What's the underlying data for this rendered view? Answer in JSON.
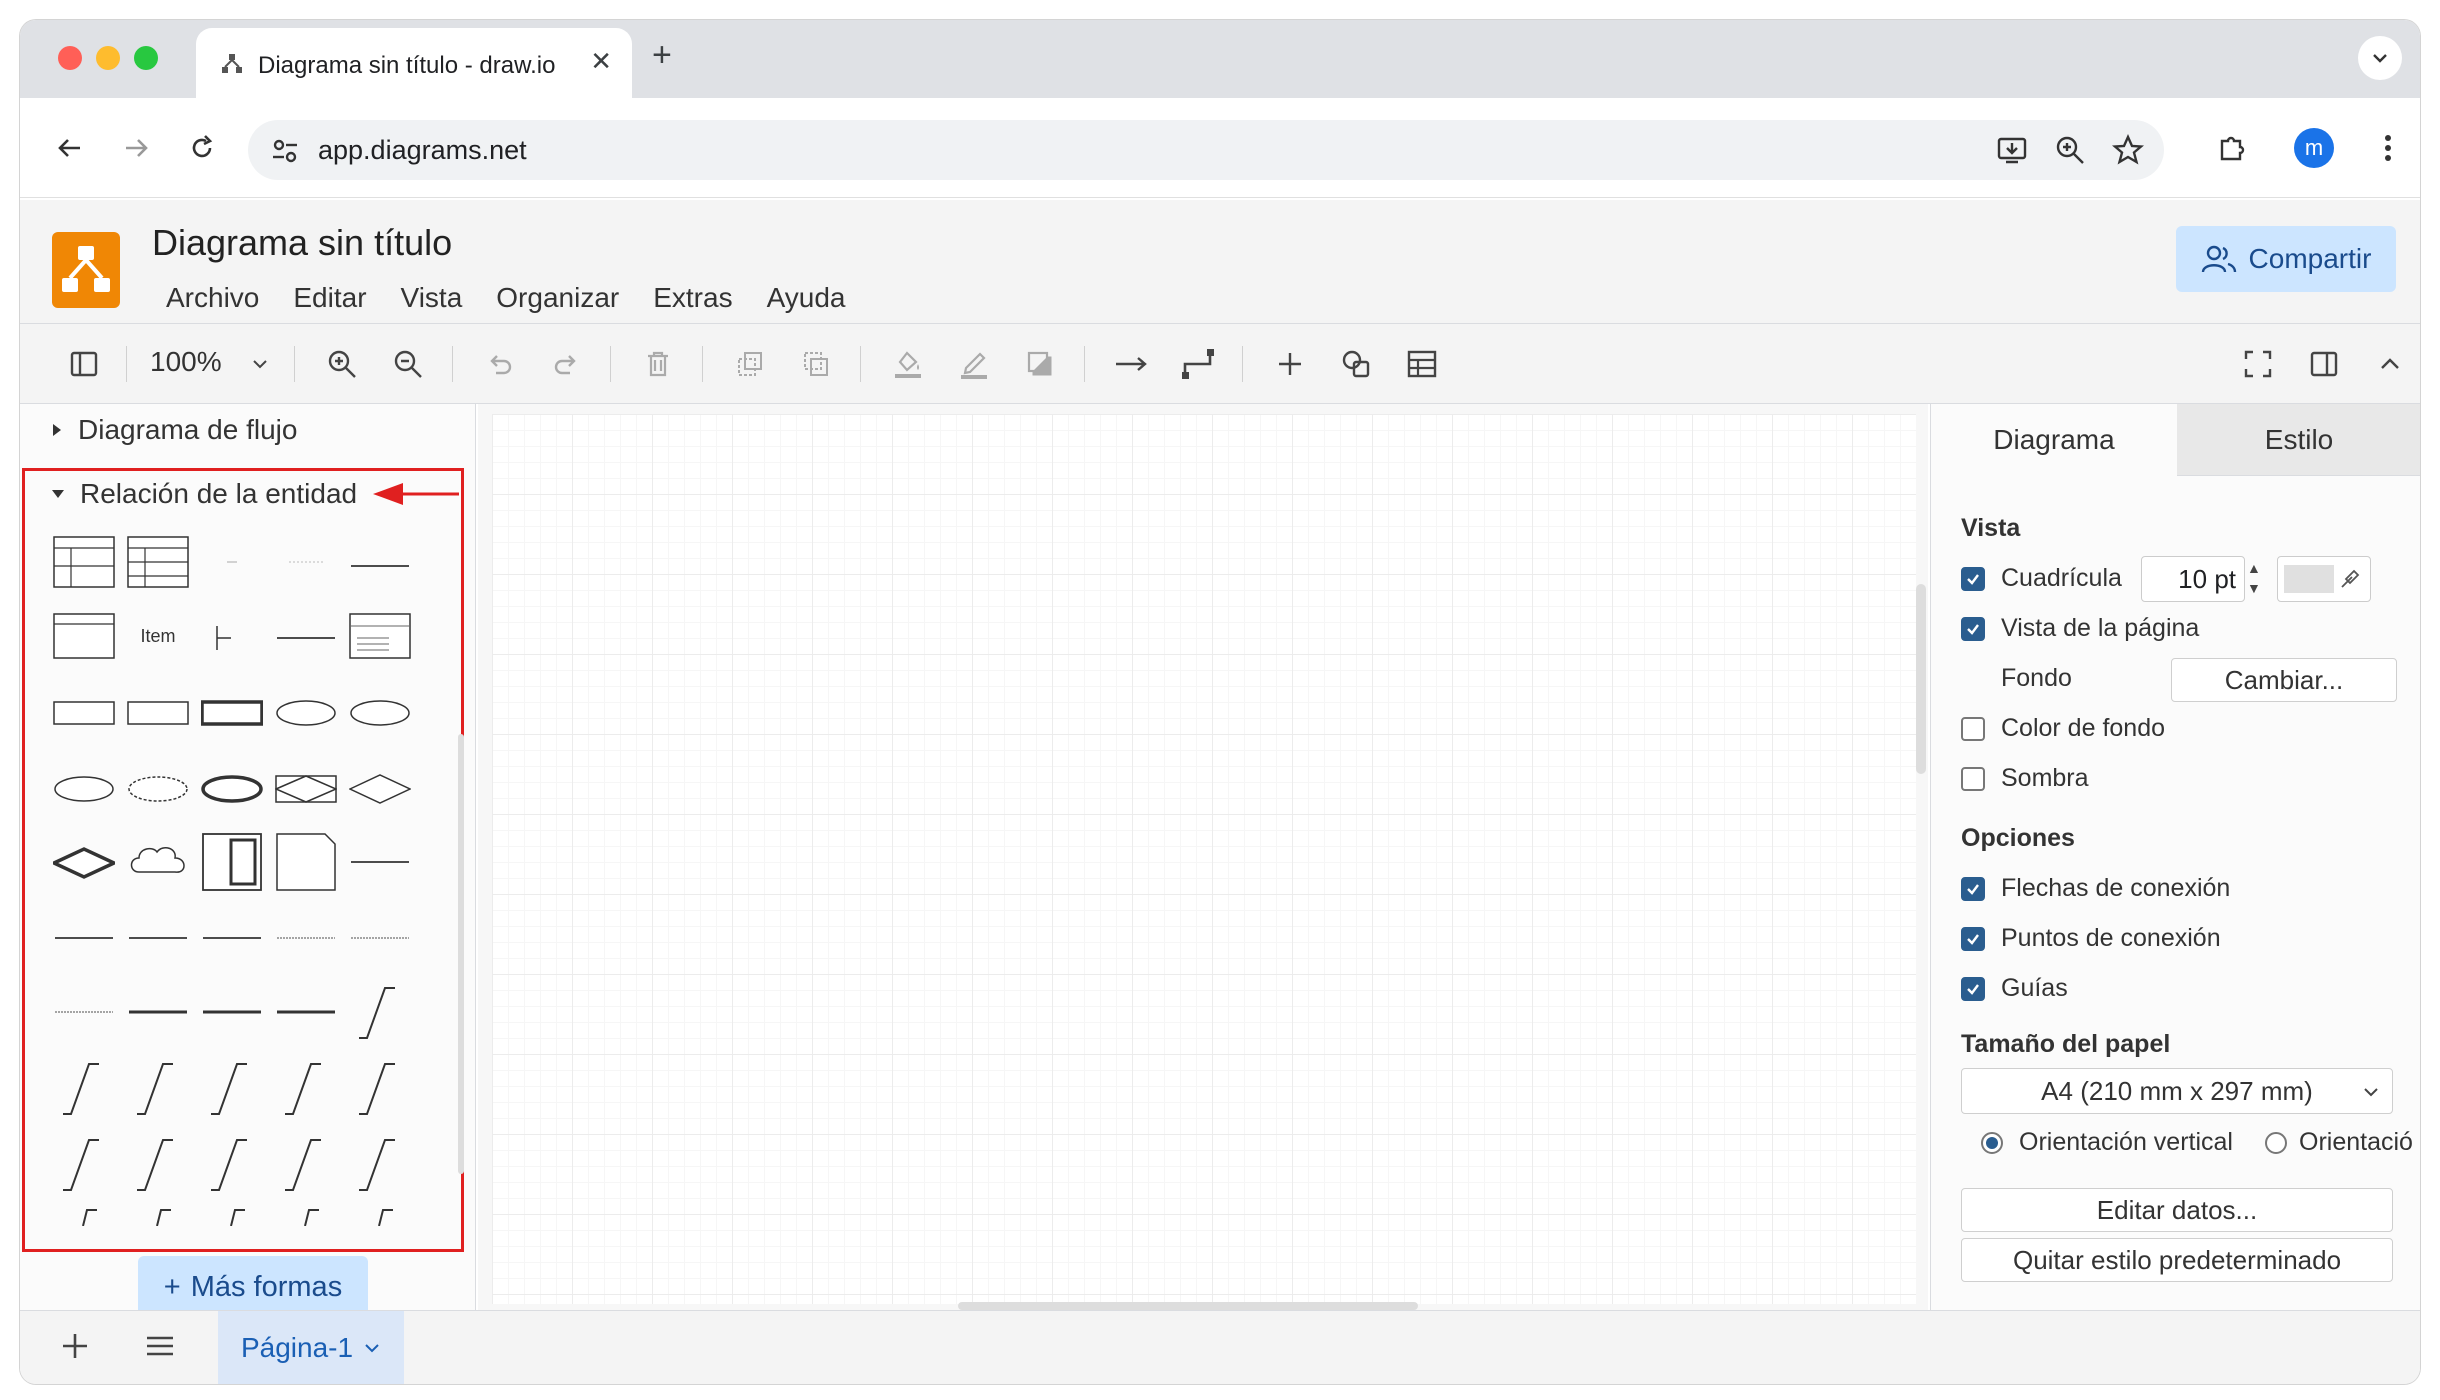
{
  "browser": {
    "tab_title": "Diagrama sin título - draw.io",
    "url": "app.diagrams.net",
    "avatar_letter": "m"
  },
  "app": {
    "title": "Diagrama sin título",
    "menu": [
      "Archivo",
      "Editar",
      "Vista",
      "Organizar",
      "Extras",
      "Ayuda"
    ],
    "share_label": "Compartir",
    "zoom": "100%"
  },
  "left_panel": {
    "sections": [
      {
        "label": "Diagrama de flujo",
        "expanded": false
      },
      {
        "label": "Relación de la entidad",
        "expanded": true
      }
    ],
    "shape_labels": [
      "Item"
    ],
    "more_shapes": "Más formas"
  },
  "right_panel": {
    "tabs": [
      "Diagrama",
      "Estilo"
    ],
    "vista": {
      "heading": "Vista",
      "grid_label": "Cuadrícula",
      "grid_value": "10 pt",
      "page_view_label": "Vista de la página",
      "background_label": "Fondo",
      "change_button": "Cambiar...",
      "bg_color_label": "Color de fondo",
      "shadow_label": "Sombra"
    },
    "options": {
      "heading": "Opciones",
      "connection_arrows": "Flechas de conexión",
      "connection_points": "Puntos de conexión",
      "guides": "Guías"
    },
    "paper": {
      "heading": "Tamaño del papel",
      "size": "A4 (210 mm x 297 mm)",
      "portrait": "Orientación vertical",
      "landscape": "Orientació"
    },
    "edit_data": "Editar datos...",
    "clear_style": "Quitar estilo predeterminado"
  },
  "bottom": {
    "page_tab": "Página-1"
  },
  "colors": {
    "highlight": "#e02020",
    "accent": "#cce5ff",
    "logo": "#f08705"
  }
}
